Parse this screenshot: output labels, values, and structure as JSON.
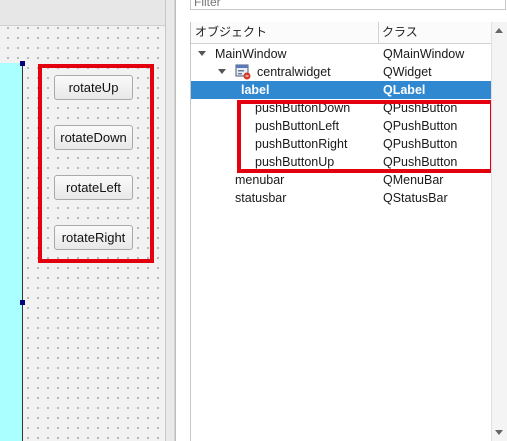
{
  "canvas": {
    "buttons": [
      {
        "label": "rotateUp"
      },
      {
        "label": "rotateDown"
      },
      {
        "label": "rotateLeft"
      },
      {
        "label": "rotateRight"
      }
    ]
  },
  "inspector": {
    "filter_placeholder": "Filter",
    "columns": {
      "object": "オブジェクト",
      "class": "クラス"
    },
    "rows": [
      {
        "name": "MainWindow",
        "class": "QMainWindow"
      },
      {
        "name": "centralwidget",
        "class": "QWidget"
      },
      {
        "name": "label",
        "class": "QLabel"
      },
      {
        "name": "pushButtonDown",
        "class": "QPushButton"
      },
      {
        "name": "pushButtonLeft",
        "class": "QPushButton"
      },
      {
        "name": "pushButtonRight",
        "class": "QPushButton"
      },
      {
        "name": "pushButtonUp",
        "class": "QPushButton"
      },
      {
        "name": "menubar",
        "class": "QMenuBar"
      },
      {
        "name": "statusbar",
        "class": "QStatusBar"
      }
    ],
    "selected_row": "label"
  },
  "colors": {
    "highlight_box": "#e3000f",
    "selection": "#3088d0",
    "label_widget": "#aaffff",
    "selection_handle": "#000080"
  },
  "icons": {
    "expand": "chevron-down-icon",
    "widget": "widget-icon",
    "scroll_up": "scroll-up-arrow-icon",
    "scroll_down": "scroll-down-arrow-icon"
  }
}
